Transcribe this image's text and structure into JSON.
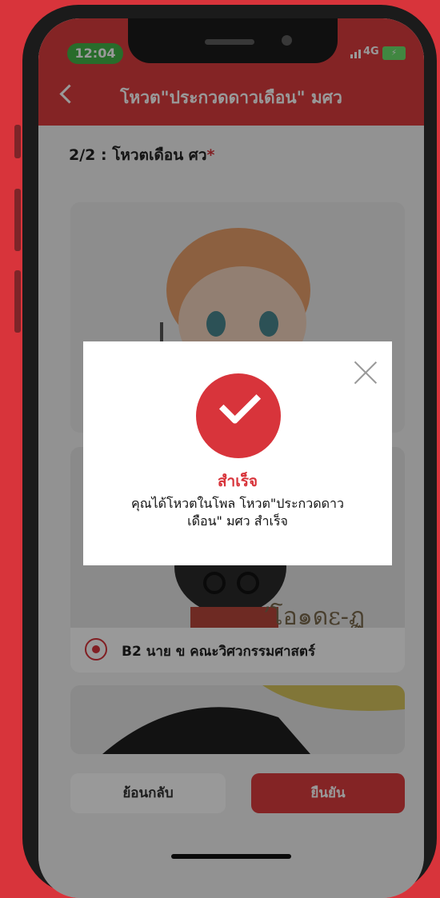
{
  "status_bar": {
    "time": "12:04",
    "network": "4G"
  },
  "header": {
    "title": "โหวต\"ประกวดดาวเดือน\" มศว"
  },
  "section": {
    "title": "2/2 : โหวตเดือน ศว",
    "required_mark": "*"
  },
  "options": [
    {
      "label": "",
      "selected": false
    },
    {
      "label": "B2 นาย ข คณะวิศวกรรมศาสตร์",
      "selected": true
    },
    {
      "label": "",
      "selected": false
    }
  ],
  "footer": {
    "back_label": "ย้อนกลับ",
    "confirm_label": "ยืนยัน"
  },
  "modal": {
    "title": "สำเร็จ",
    "message": "คุณได้โหวตในโพล โหวต\"ประกวดดาวเดือน\" มศว สำเร็จ"
  },
  "colors": {
    "accent": "#dc3c3f",
    "status_pill": "#43b449"
  }
}
